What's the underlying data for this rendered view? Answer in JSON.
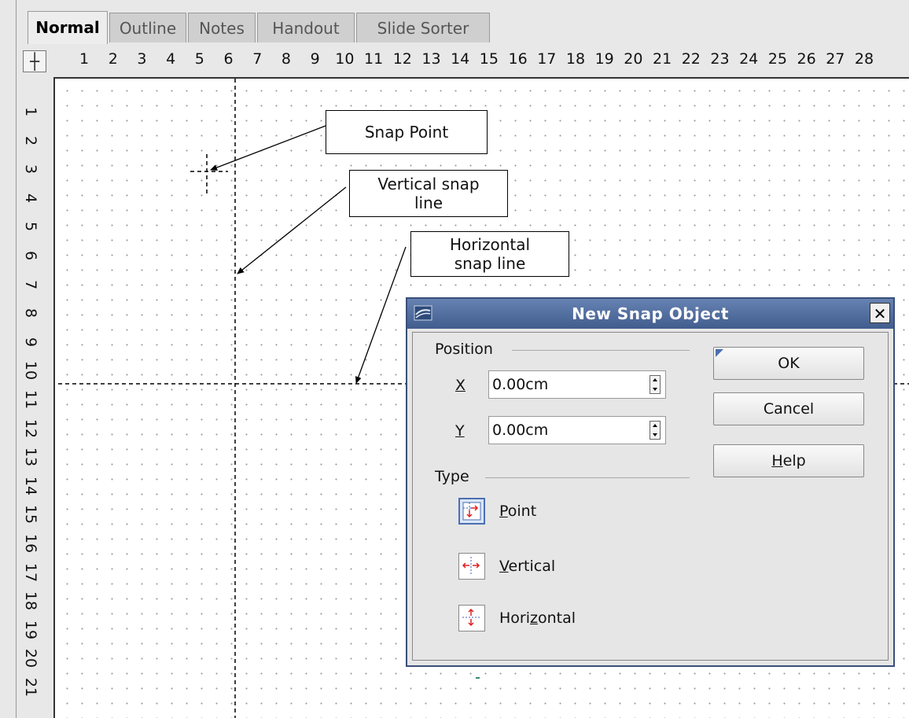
{
  "tabs": [
    {
      "label": "Normal",
      "active": true
    },
    {
      "label": "Outline",
      "active": false
    },
    {
      "label": "Notes",
      "active": false
    },
    {
      "label": "Handout",
      "active": false
    },
    {
      "label": "Slide Sorter",
      "active": false
    }
  ],
  "ruler": {
    "horizontal": [
      "1",
      "2",
      "3",
      "4",
      "5",
      "6",
      "7",
      "8",
      "9",
      "10",
      "11",
      "12",
      "13",
      "14",
      "15",
      "16",
      "17",
      "18",
      "19",
      "20",
      "21",
      "22",
      "23",
      "24",
      "25",
      "26",
      "27",
      "28"
    ],
    "vertical": [
      "1",
      "2",
      "3",
      "4",
      "5",
      "6",
      "7",
      "8",
      "9",
      "10",
      "11",
      "12",
      "13",
      "14",
      "15",
      "16",
      "17",
      "18",
      "19",
      "20",
      "21"
    ]
  },
  "callouts": {
    "snap_point": "Snap Point",
    "vertical_line": [
      "Vertical snap",
      "line"
    ],
    "horizontal_line": [
      "Horizontal",
      "snap line"
    ]
  },
  "dialog": {
    "title": "New Snap Object",
    "position_label": "Position",
    "x_label": "X",
    "x_value": "0.00cm",
    "y_label": "Y",
    "y_value": "0.00cm",
    "type_label": "Type",
    "types": {
      "point": {
        "pre": "",
        "acc": "P",
        "post": "oint",
        "selected": true
      },
      "vertical": {
        "pre": "",
        "acc": "V",
        "post": "ertical",
        "selected": false
      },
      "horizontal": {
        "pre": "Hori",
        "acc": "z",
        "post": "ontal",
        "selected": false
      }
    },
    "ok": "OK",
    "cancel": "Cancel",
    "help_acc": "H",
    "help_rest": "elp"
  },
  "colors": {
    "title_bar": "#4e6a9a",
    "selected_type": "#4a6fb0",
    "arrow_red": "#e02020"
  }
}
